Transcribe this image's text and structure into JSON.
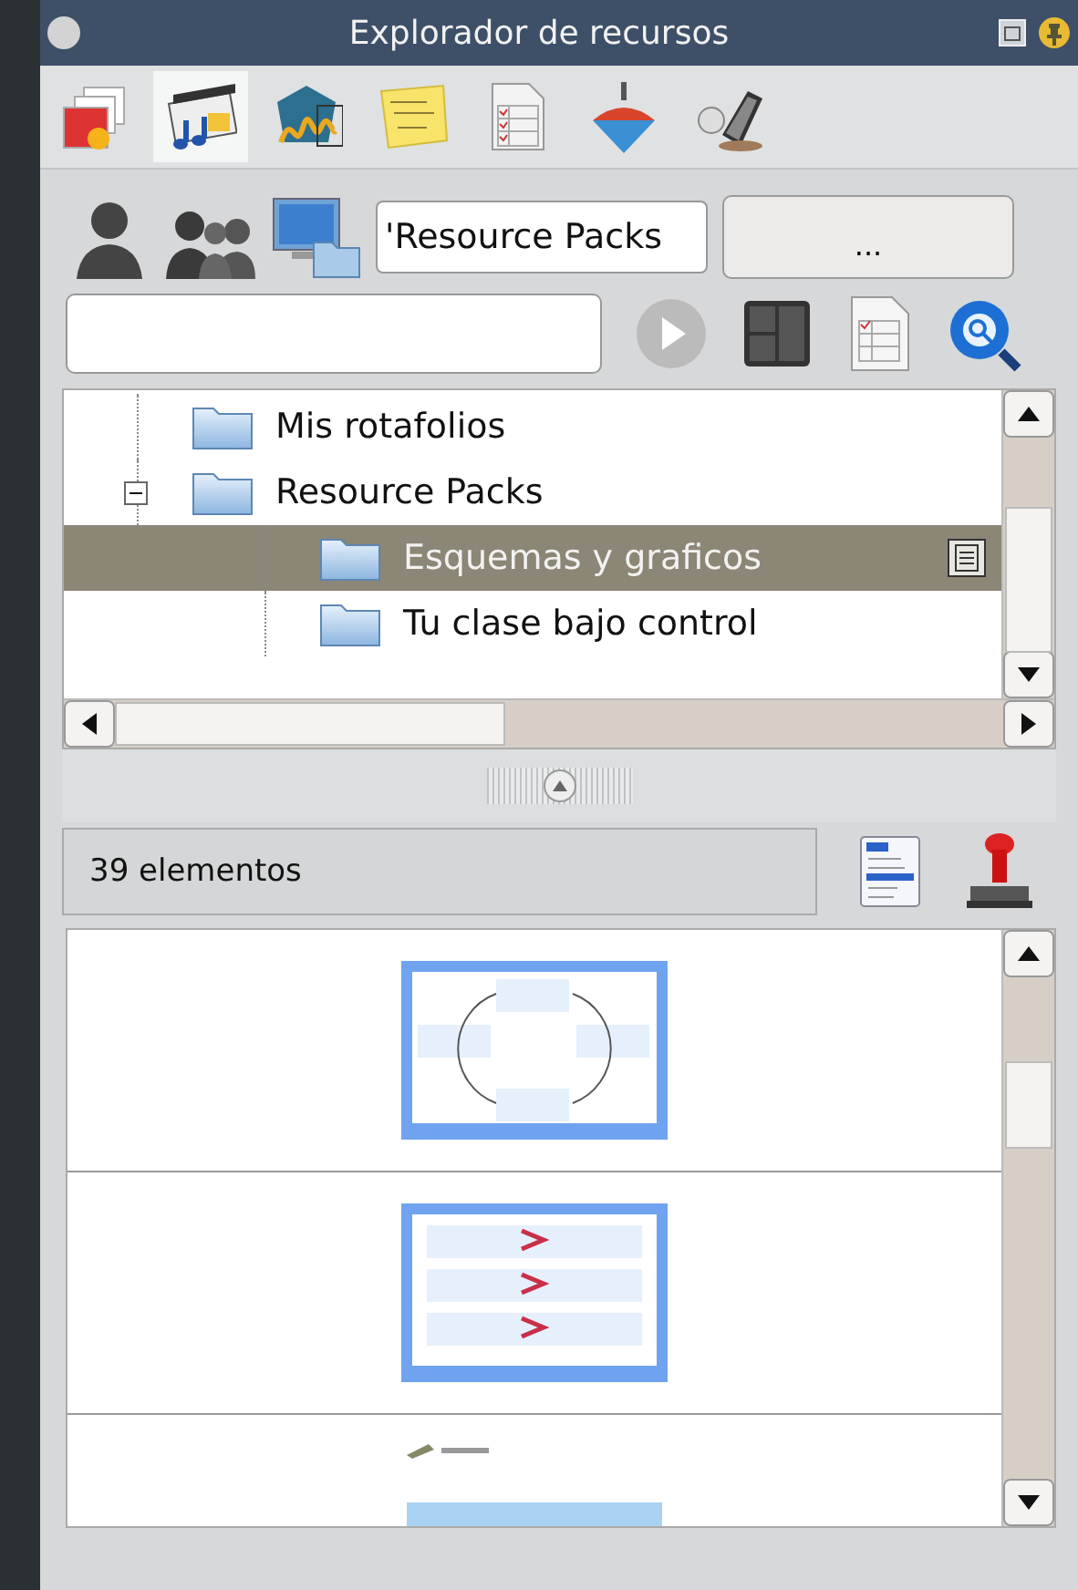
{
  "window": {
    "title": "Explorador de recursos"
  },
  "toolbar_tabs": [
    {
      "kind": "images",
      "selected": false
    },
    {
      "kind": "media",
      "selected": true
    },
    {
      "kind": "flash",
      "selected": false
    },
    {
      "kind": "notes",
      "selected": false
    },
    {
      "kind": "form",
      "selected": false
    },
    {
      "kind": "spinner",
      "selected": false
    },
    {
      "kind": "device",
      "selected": false
    }
  ],
  "path_field": {
    "value": "'Resource Packs"
  },
  "browse_button": {
    "label": "..."
  },
  "tree": [
    {
      "label": "Mis rotafolios",
      "selected": false
    },
    {
      "label": "Resource Packs",
      "selected": false,
      "expanded": true,
      "children": [
        {
          "label": "Esquemas y graficos",
          "selected": true
        },
        {
          "label": "Tu clase bajo control",
          "selected": false
        }
      ]
    }
  ],
  "status": {
    "count": "39 elementos"
  },
  "thumbnails": [
    {
      "kind": "cycle"
    },
    {
      "kind": "steps"
    },
    {
      "kind": "question"
    }
  ]
}
